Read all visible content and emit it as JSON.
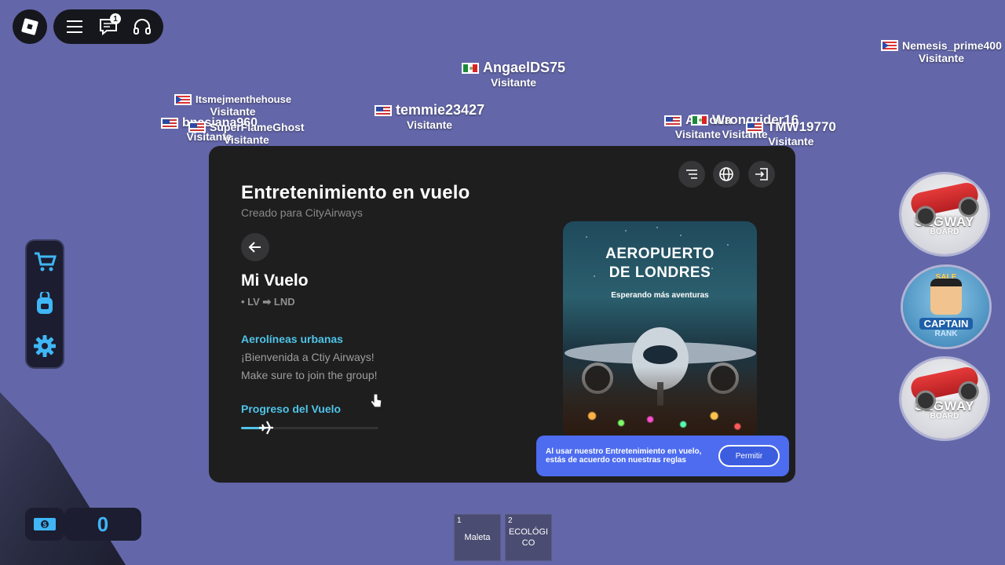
{
  "topbar": {
    "notification_count": "1"
  },
  "players": [
    {
      "name": "AngaelDS75",
      "role": "Visitante",
      "flag": "mx"
    },
    {
      "name": "Nemesis_prime400",
      "role": "Visitante",
      "flag": "pr"
    },
    {
      "name": "Itsmejmenthehouse",
      "role": "Visitante",
      "flag": "pr"
    },
    {
      "name": "temmie23427",
      "role": "Visitante",
      "flag": "us"
    },
    {
      "name": "bnasiana960",
      "role": "Visitante",
      "flag": "us"
    },
    {
      "name": "SuperFlameGhost",
      "role": "Visitante",
      "flag": "us"
    },
    {
      "name": "Alluoua",
      "role": "Visitante",
      "flag": "us"
    },
    {
      "name": "Wrongrider16",
      "role": "Visitante",
      "flag": "mx"
    },
    {
      "name": "TMW19770",
      "role": "Visitante",
      "flag": "us"
    }
  ],
  "modal": {
    "title": "Entretenimiento en vuelo",
    "subtitle": "Creado para CityAirways",
    "flight_title": "Mi Vuelo",
    "route": "• LV ➡ LND",
    "airline": "Aerolíneas urbanas",
    "message_line1": "¡Bienvenida a Ctiy Airways!",
    "message_line2": "Make sure to join the group!",
    "progress_label": "Progreso del Vuelo",
    "progress_fraction": 0.18,
    "poster": {
      "title_line1": "AEROPUERTO",
      "title_line2": "DE LONDRES",
      "subtitle": "Esperando más aventuras"
    },
    "consent": {
      "text": "Al usar nuestro Entretenimiento en vuelo, estás de acuerdo con nuestras reglas",
      "button": "Permitir"
    }
  },
  "currency": {
    "value": "0"
  },
  "shop_items": [
    {
      "title": "SEGWAY",
      "sub": "BOARD"
    },
    {
      "title": "CAPTAIN",
      "sub": "RANK",
      "top": "SALE"
    },
    {
      "title": "SEGWAY",
      "sub": "BOARD"
    }
  ],
  "hotbar": [
    {
      "num": "1",
      "label": "Maleta"
    },
    {
      "num": "2",
      "label": "ECOLÓGICO"
    }
  ],
  "colors": {
    "background": "#6366a8",
    "accent": "#4fc4e8",
    "consent_bg": "#4d6cf0",
    "money": "#3fb6f5"
  }
}
